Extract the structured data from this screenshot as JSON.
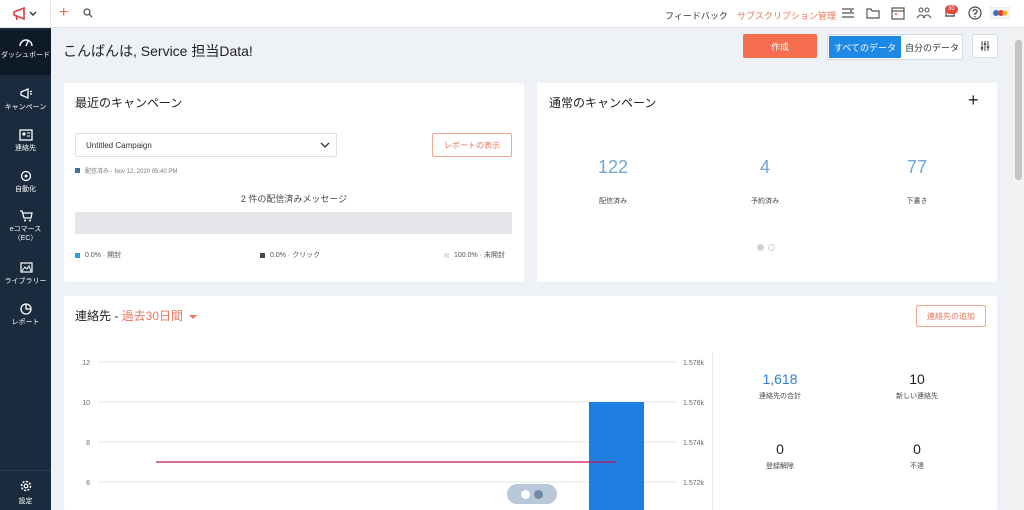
{
  "topbar": {
    "feedback": "フィードバック",
    "subscription": "サブスクリプション管理",
    "notification_count": "30"
  },
  "sidebar": {
    "items": [
      {
        "label": "ダッシュボード",
        "icon": "dashboard-icon"
      },
      {
        "label": "キャンペーン",
        "icon": "megaphone-icon"
      },
      {
        "label": "連絡先",
        "icon": "contacts-icon"
      },
      {
        "label": "自動化",
        "icon": "automation-icon"
      },
      {
        "label": "eコマース（EC）",
        "icon": "cart-icon"
      },
      {
        "label": "ライブラリー",
        "icon": "library-icon"
      },
      {
        "label": "レポート",
        "icon": "report-icon"
      }
    ],
    "settings": "設定"
  },
  "header": {
    "greeting": "こんばんは, Service 担当Data!",
    "create": "作成",
    "all_data": "すべてのデータ",
    "my_data": "自分のデータ"
  },
  "recent_campaign": {
    "title": "最近のキャンペーン",
    "selected": "Untitled Campaign",
    "view_report": "レポートの表示",
    "sent_info": "配信済み - Nov 12, 2020 05:40 PM",
    "delivered_title": "2 件の配信済みメッセージ",
    "opened_pct": 0.0,
    "legend": {
      "opened": "0.0% · 開封",
      "clicked": "0.0% · クリック",
      "unopened": "100.0% · 未開封"
    },
    "colors": {
      "opened": "#2d9cdb",
      "clicked": "#404a57",
      "unopened": "#e2e4e7"
    }
  },
  "normal_campaign": {
    "title": "通常のキャンペーン",
    "add": "+",
    "stats": [
      {
        "value": "122",
        "label": "配信済み"
      },
      {
        "value": "4",
        "label": "予約済み"
      },
      {
        "value": "77",
        "label": "下書き"
      }
    ]
  },
  "contacts": {
    "title": "連絡先 - ",
    "period": "過去30日間",
    "add_contact": "連絡先の追加",
    "stats": [
      {
        "value": "1,618",
        "label": "連絡先の合計"
      },
      {
        "value": "10",
        "label": "新しい連絡先"
      },
      {
        "value": "0",
        "label": "登録解除"
      },
      {
        "value": "0",
        "label": "不達"
      }
    ]
  },
  "chart_data": {
    "type": "bar",
    "left_axis": {
      "ticks": [
        12,
        10,
        8,
        6
      ],
      "ylim": [
        6,
        12
      ]
    },
    "right_axis": {
      "ticks": [
        "1.578k",
        "1.576k",
        "1.574k",
        "1.572k"
      ]
    },
    "series": [
      {
        "type": "bar",
        "values": [
          10
        ],
        "color": "#1e7fe0"
      },
      {
        "type": "line",
        "values": [
          7,
          7
        ],
        "color": "#c2185b"
      }
    ]
  }
}
